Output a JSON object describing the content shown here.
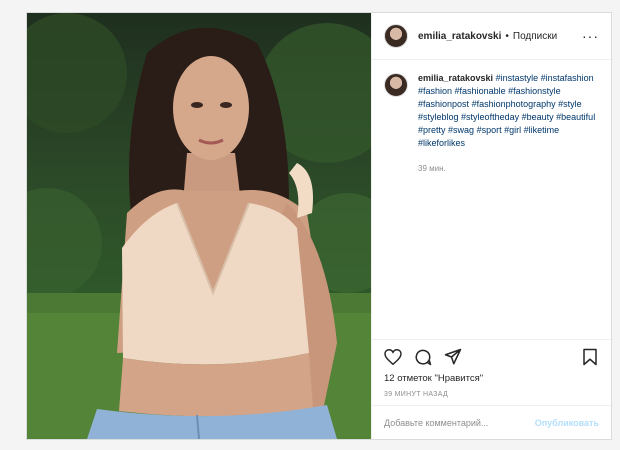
{
  "header": {
    "username": "emilia_ratakovski",
    "separator": "•",
    "follow_label": "Подписки",
    "more_label": "···"
  },
  "caption": {
    "username": "emilia_ratakovski",
    "tags": [
      "#instastyle",
      "#instafashion",
      "#fashion",
      "#fashionable",
      "#fashionstyle",
      "#fashionpost",
      "#fashionphotography",
      "#style",
      "#styleblog",
      "#styleoftheday",
      "#beauty",
      "#beautiful",
      "#pretty",
      "#swag",
      "#sport",
      "#girl",
      "#liketime",
      "#likeforlikes"
    ],
    "time": "39 мин."
  },
  "actions": {
    "like_icon": "heart-icon",
    "comment_icon": "comment-icon",
    "share_icon": "share-icon",
    "save_icon": "bookmark-icon"
  },
  "likes_text": "12 отметок \"Нравится\"",
  "posted_ago": "39 МИНУТ НАЗАД",
  "comment": {
    "placeholder": "Добавьте комментарий...",
    "post_label": "Опубликовать"
  },
  "colors": {
    "link": "#00376b",
    "muted": "#8e8e8e",
    "post_button": "#b2dffc"
  }
}
